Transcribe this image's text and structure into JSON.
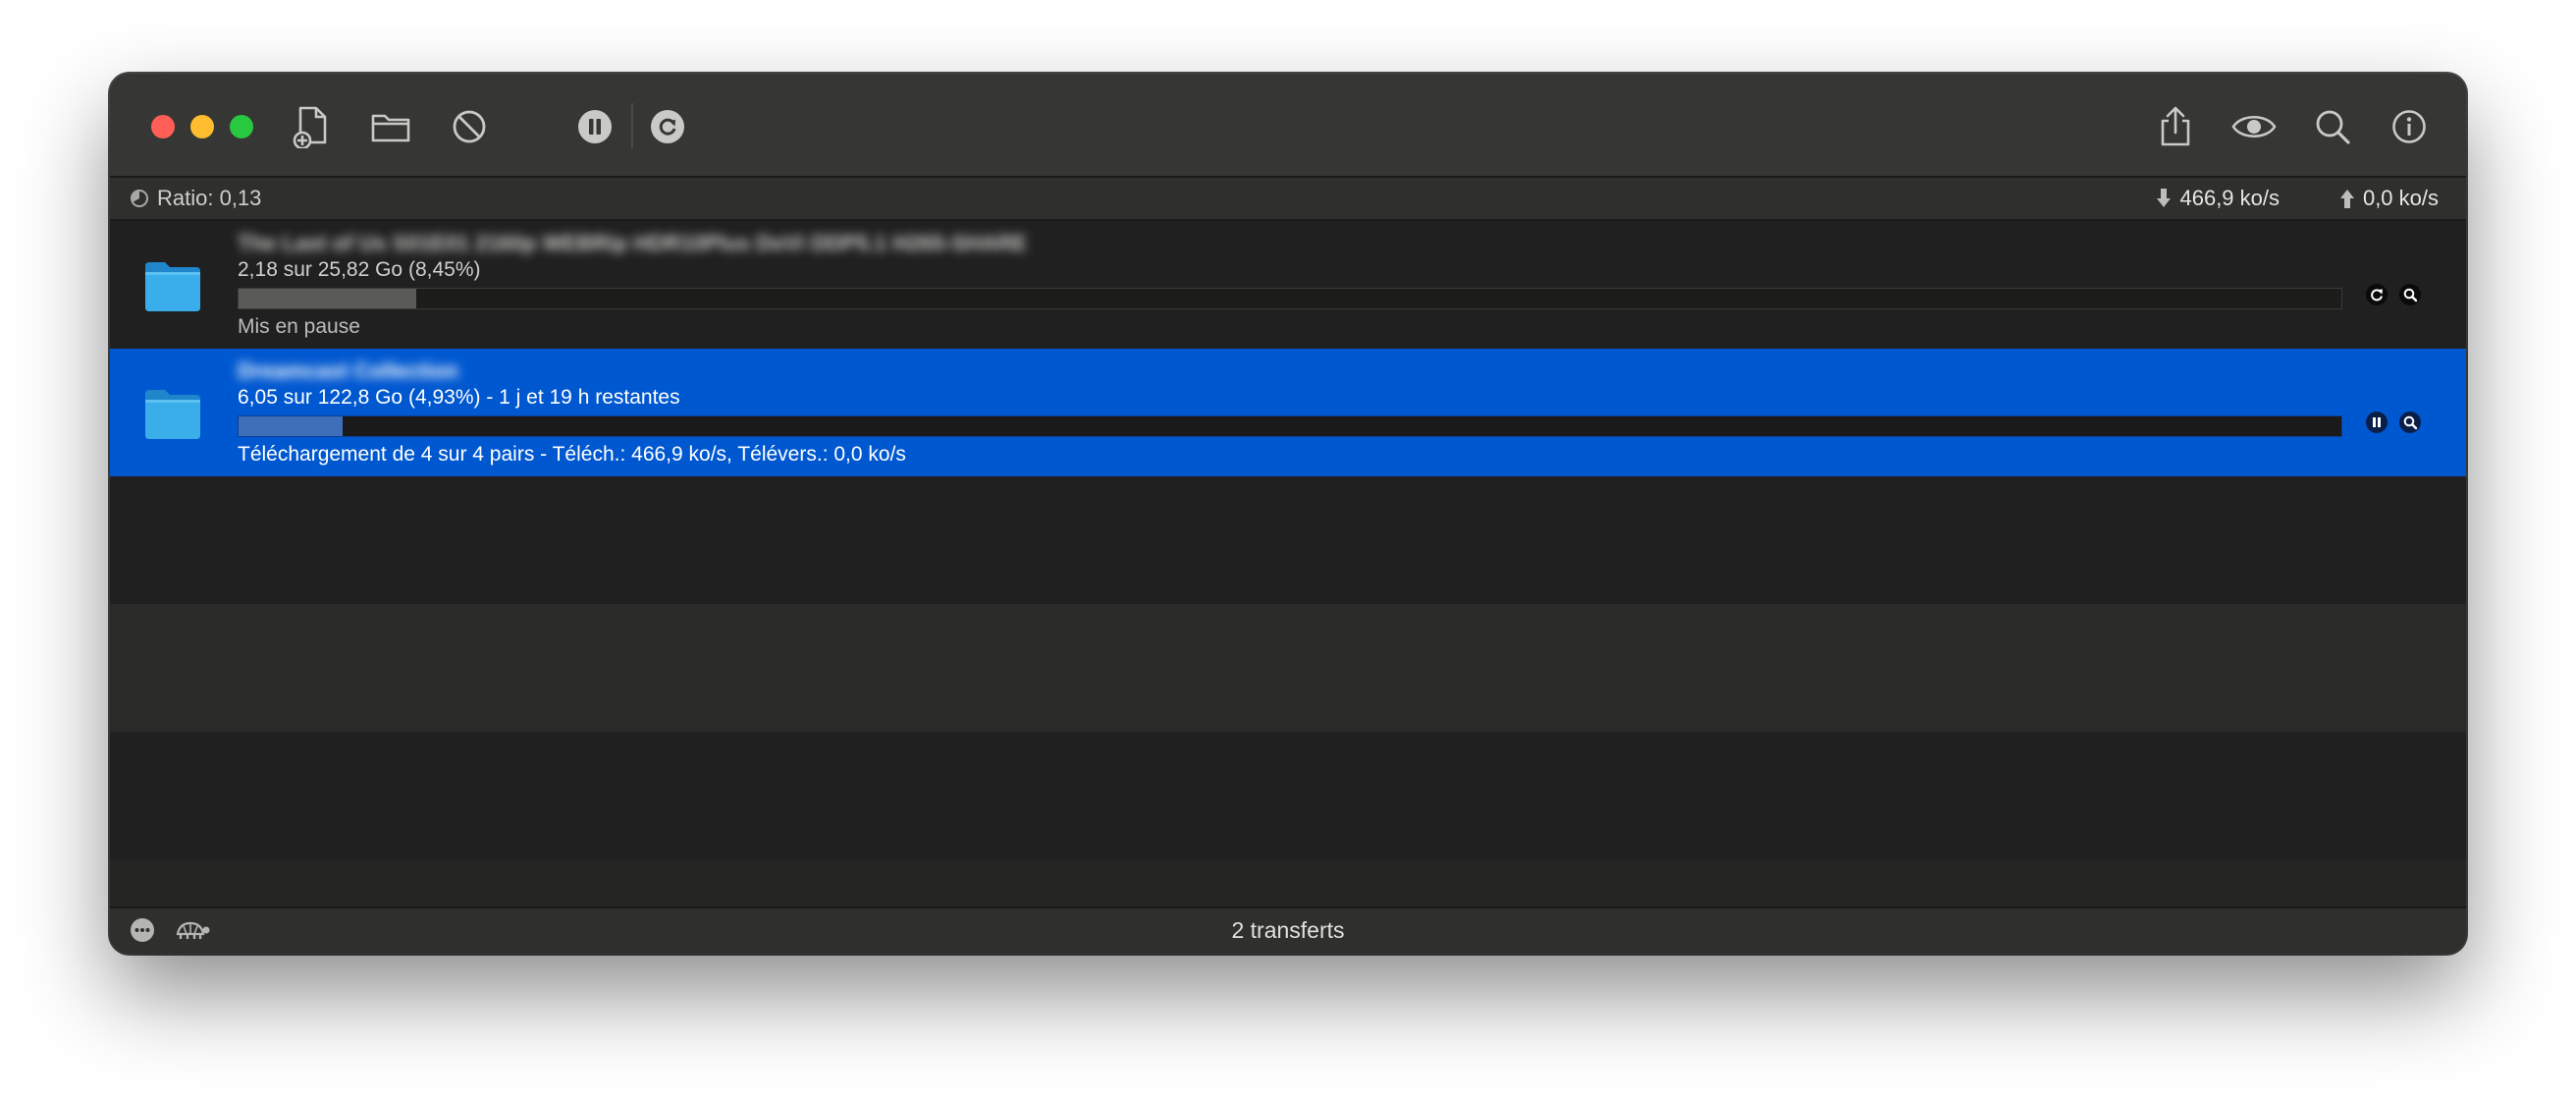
{
  "toolbar": {
    "buttons": [
      "create-torrent",
      "open-torrent",
      "remove",
      "pause-all",
      "resume-all",
      "share",
      "quick-look",
      "search",
      "inspector"
    ]
  },
  "stats": {
    "ratio": "Ratio: 0,13",
    "download_rate": "466,9 ko/s",
    "upload_rate": "0,0 ko/s"
  },
  "transfers": [
    {
      "name": "The Last of Us S01E01 2160p WEBRip HDR10Plus DoVi DDP5.1 H265-SHARE",
      "progress_text": "2,18 sur 25,82 Go (8,45%)",
      "percent": 8.45,
      "status_text": "Mis en pause",
      "selected": false,
      "action": "resume"
    },
    {
      "name": "Dreamcast Collection",
      "progress_text": "6,05 sur 122,8 Go (4,93%) - 1 j et 19 h restantes",
      "percent": 4.93,
      "status_text": "Téléchargement de 4 sur 4 pairs - Téléch.: 466,9 ko/s, Télévers.: 0,0 ko/s",
      "selected": true,
      "action": "pause"
    }
  ],
  "footer": {
    "count": "2 transferts"
  },
  "colors": {
    "selection": "#0058d0",
    "folder": "#35a8e8",
    "progress_paused": "#5a5a58",
    "progress_active": "#3f6fb8"
  }
}
